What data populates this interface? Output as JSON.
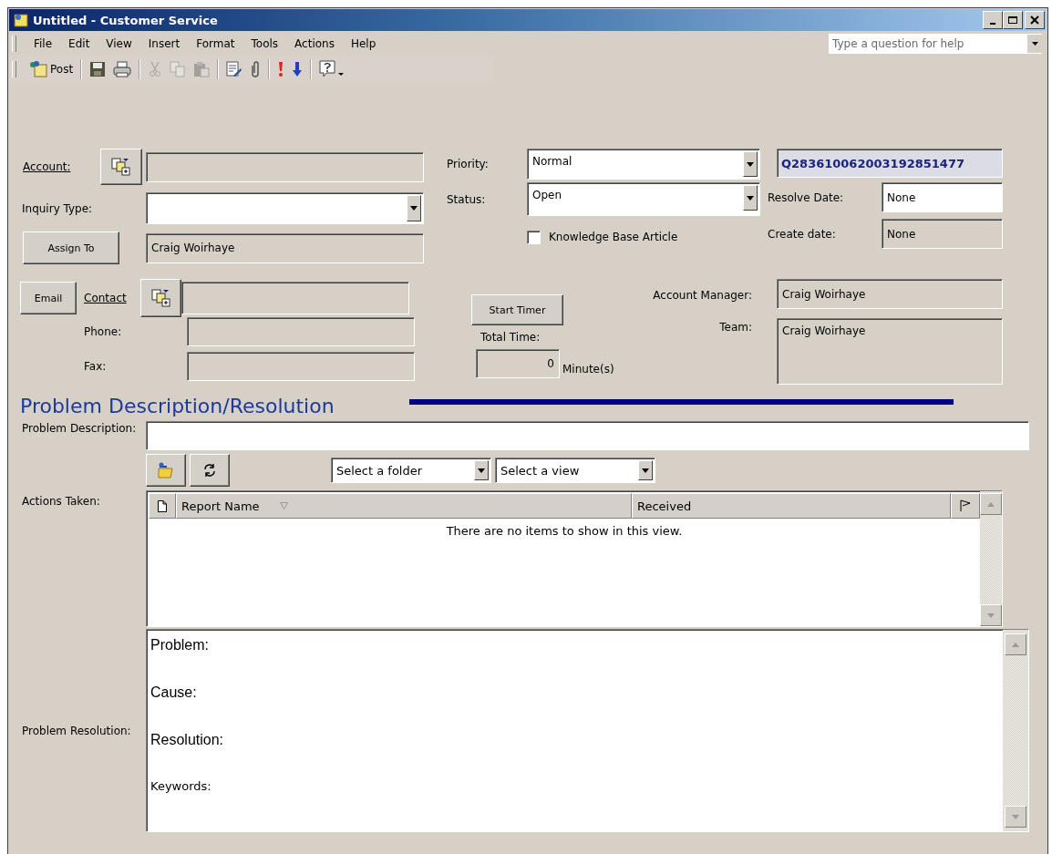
{
  "window": {
    "title": "Untitled - Customer Service"
  },
  "menu": [
    {
      "label": "File"
    },
    {
      "label": "Edit"
    },
    {
      "label": "View"
    },
    {
      "label": "Insert"
    },
    {
      "label": "Format"
    },
    {
      "label": "Tools"
    },
    {
      "label": "Actions"
    },
    {
      "label": "Help"
    }
  ],
  "help_box": {
    "placeholder": "Type a question for help"
  },
  "toolbar": {
    "groups": [
      [
        {
          "kind": "post",
          "label": "Post",
          "disabled": false
        }
      ],
      [
        {
          "kind": "save",
          "disabled": false
        },
        {
          "kind": "print",
          "disabled": false
        }
      ],
      [
        {
          "kind": "cut",
          "disabled": true
        },
        {
          "kind": "copy",
          "disabled": true
        },
        {
          "kind": "paste",
          "disabled": true
        }
      ],
      [
        {
          "kind": "insert_file",
          "disabled": false
        },
        {
          "kind": "attach",
          "disabled": false
        }
      ],
      [
        {
          "kind": "high_importance",
          "disabled": false
        },
        {
          "kind": "low_importance",
          "disabled": false
        }
      ],
      [
        {
          "kind": "help",
          "disabled": false
        }
      ]
    ]
  },
  "account": {
    "label": "Account:"
  },
  "inquiry_type": {
    "label": "Inquiry Type:"
  },
  "assign_to": {
    "button": "Assign To",
    "value": "Craig Woirhaye"
  },
  "contact": {
    "email_button": "Email",
    "label": "Contact",
    "phone_label": "Phone:",
    "fax_label": "Fax:"
  },
  "priority": {
    "label": "Priority:",
    "value": "Normal"
  },
  "status": {
    "label": "Status:",
    "value": "Open"
  },
  "knowledge_base": {
    "label": "Knowledge Base Article",
    "checked": false
  },
  "ticket_number": "Q283610062003192851477",
  "resolve_date": {
    "label": "Resolve Date:",
    "value": "None"
  },
  "create_date": {
    "label": "Create date:",
    "value": "None"
  },
  "timer": {
    "button": "Start Timer",
    "label": "Total Time:",
    "value": "0",
    "unit": "Minute(s)"
  },
  "account_manager": {
    "label": "Account Manager:",
    "value": "Craig Woirhaye"
  },
  "team": {
    "label": "Team:",
    "value": "Craig Woirhaye"
  },
  "section_title": "Problem Description/Resolution",
  "problem_description": {
    "label": "Problem Description:"
  },
  "actions": {
    "label": "Actions Taken:",
    "folder_select": "Select a folder",
    "view_select": "Select a view",
    "columns": [
      {
        "label": "Report Name"
      },
      {
        "label": "Received"
      }
    ],
    "empty_message": "There are no items to show in this view."
  },
  "resolution": {
    "label": "Problem Resolution:",
    "lines": [
      {
        "text": "Problem:",
        "kind": "large"
      },
      {
        "text": "Cause:",
        "kind": "large"
      },
      {
        "text": "Resolution:",
        "kind": "large"
      },
      {
        "text": "Keywords:",
        "kind": "small"
      }
    ]
  }
}
